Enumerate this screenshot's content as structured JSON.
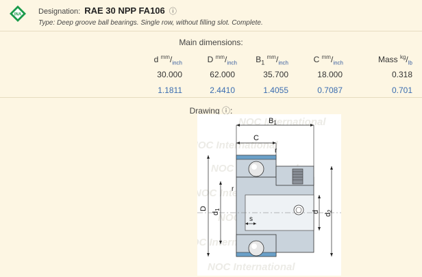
{
  "header": {
    "designation_label": "Designation:",
    "designation_value": "RAE 30 NPP FA106",
    "info_icon": "info-icon",
    "type_text": "Type: Deep groove ball bearings. Single row, without filling slot. Complete."
  },
  "dimensions": {
    "title": "Main dimensions:",
    "columns": [
      {
        "symbol": "d",
        "sup": "mm",
        "sub": "inch",
        "metric": "30.000",
        "inch": "1.1811"
      },
      {
        "symbol": "D",
        "sup": "mm",
        "sub": "inch",
        "metric": "62.000",
        "inch": "2.4410"
      },
      {
        "symbol": "B1",
        "sup": "mm",
        "sub": "inch",
        "metric": "35.700",
        "inch": "1.4055"
      },
      {
        "symbol": "C",
        "sup": "mm",
        "sub": "inch",
        "metric": "18.000",
        "inch": "0.7087"
      },
      {
        "symbol": "Mass",
        "sup": "kg",
        "sub": "lb",
        "metric": "0.318",
        "inch": "0.701"
      }
    ]
  },
  "drawing": {
    "title": "Drawing",
    "labels": {
      "B1": "B1",
      "C": "C",
      "r_top": "r",
      "r_mid": "r",
      "s": "s",
      "D": "D",
      "d1": "d1",
      "d": "d",
      "d2": "d2"
    },
    "watermark_text": "NOC International"
  },
  "colors": {
    "background": "#fdf6e3",
    "divider": "#e6dcc0",
    "inch_blue": "#3a6cb0",
    "bearing_fill": "#c9d3dc",
    "bearing_ring": "#6aa0c8",
    "logo_green": "#1a9a4a"
  }
}
